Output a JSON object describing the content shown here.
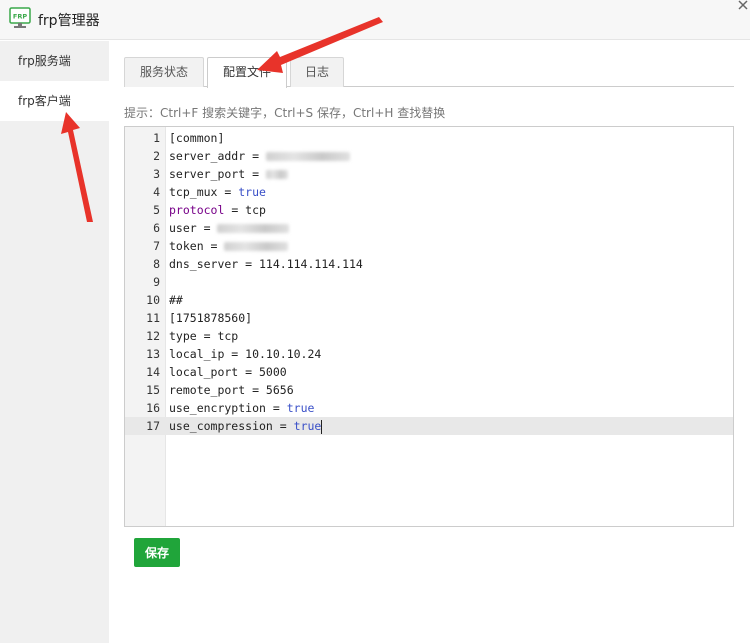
{
  "window": {
    "title": "frp管理器",
    "icon_label": "FRP"
  },
  "sidebar": {
    "items": [
      {
        "label": "frp服务端"
      },
      {
        "label": "frp客户端"
      }
    ]
  },
  "tabs": [
    {
      "label": "服务状态"
    },
    {
      "label": "配置文件"
    },
    {
      "label": "日志"
    }
  ],
  "hint": "提示：Ctrl+F 搜索关键字，Ctrl+S 保存，Ctrl+H 查找替换",
  "editor": {
    "lines": [
      {
        "num": "1",
        "text": "[common]"
      },
      {
        "num": "2",
        "key": "server_addr",
        "op": " = "
      },
      {
        "num": "3",
        "key": "server_port",
        "op": " = "
      },
      {
        "num": "4",
        "key": "tcp_mux",
        "op": " = ",
        "value": "true"
      },
      {
        "num": "5",
        "key": "protocol",
        "op": " = ",
        "value": "tcp"
      },
      {
        "num": "6",
        "key": "user",
        "op": " = "
      },
      {
        "num": "7",
        "key": "token",
        "op": " = "
      },
      {
        "num": "8",
        "text": "dns_server = 114.114.114.114"
      },
      {
        "num": "9",
        "text": ""
      },
      {
        "num": "10",
        "text": "##"
      },
      {
        "num": "11",
        "text": "[1751878560]"
      },
      {
        "num": "12",
        "text": "type = tcp"
      },
      {
        "num": "13",
        "text": "local_ip = 10.10.10.24"
      },
      {
        "num": "14",
        "text": "local_port = 5000"
      },
      {
        "num": "15",
        "text": "remote_port = 5656"
      },
      {
        "num": "16",
        "key": "use_encryption",
        "op": " = ",
        "value": "true"
      },
      {
        "num": "17",
        "key": "use_compression",
        "op": " = ",
        "value": "true"
      }
    ]
  },
  "buttons": {
    "save": "保存"
  },
  "colors": {
    "accent_green": "#20a53a",
    "annotation_red": "#e8332a",
    "keyword_blue": "#3a50c8",
    "keyword_purple": "#770088"
  }
}
